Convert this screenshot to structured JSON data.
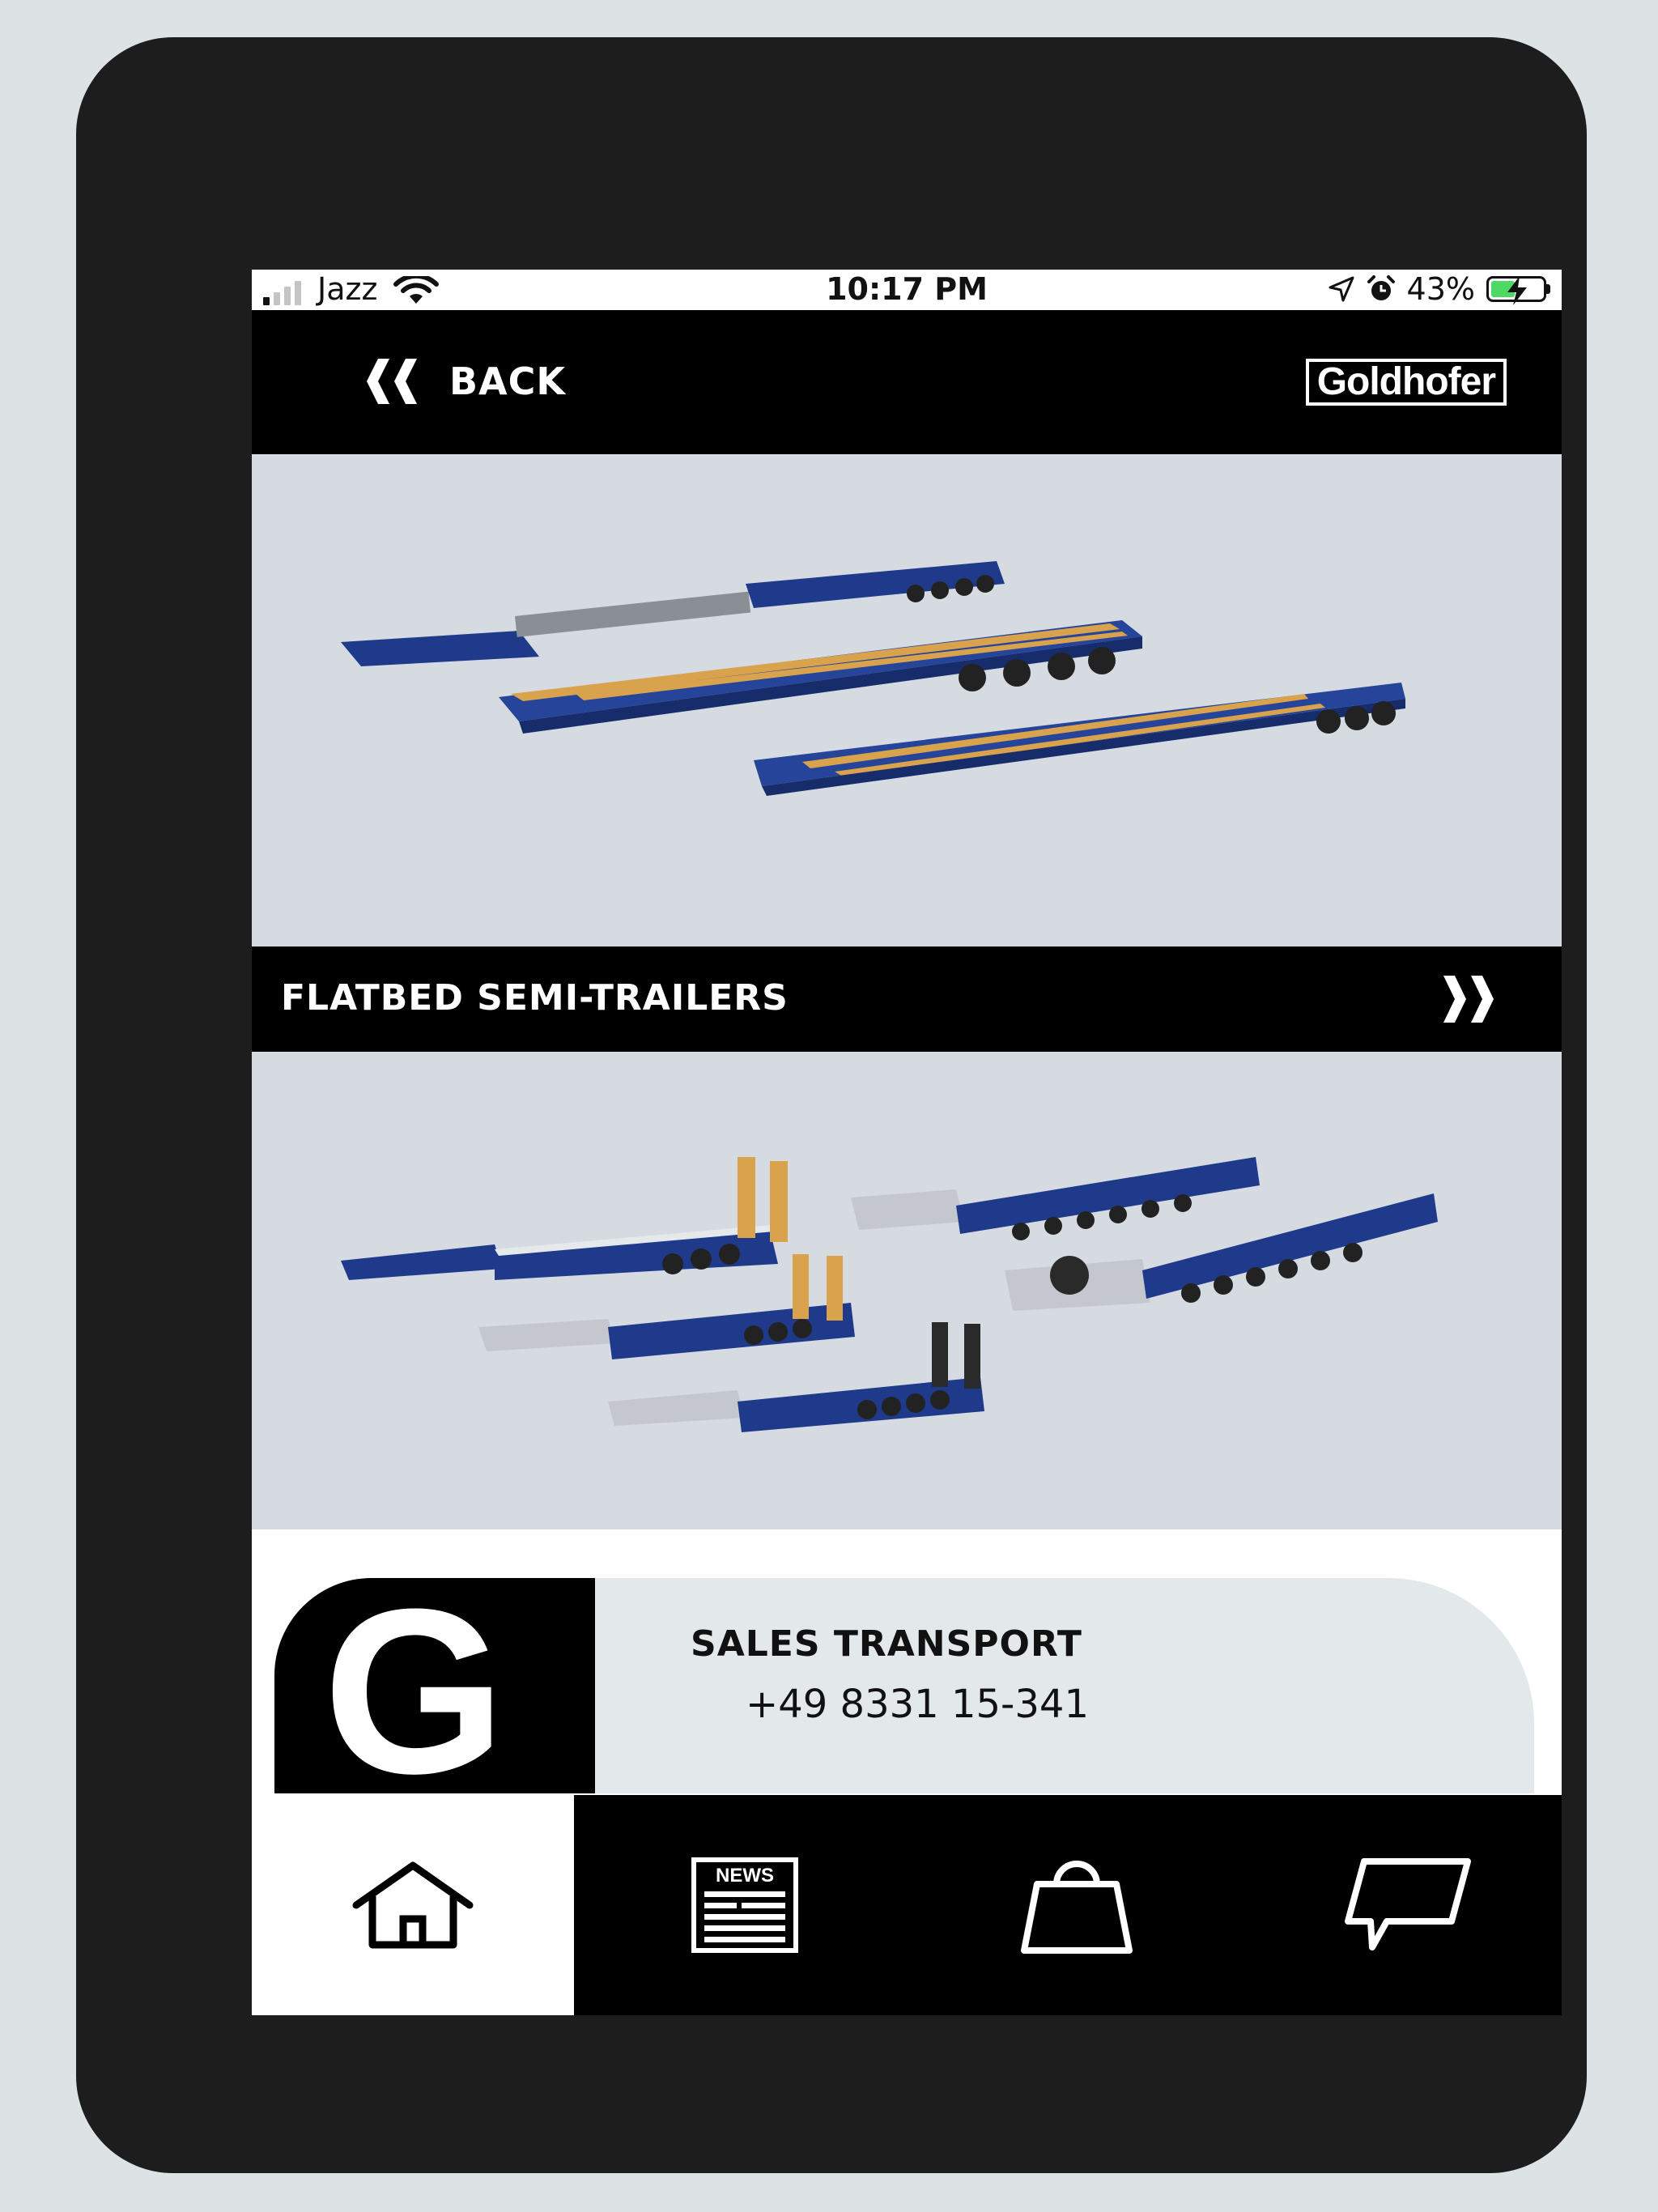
{
  "status_bar": {
    "carrier": "Jazz",
    "time": "10:17 PM",
    "battery": "43%",
    "icons": [
      "signal-icon",
      "wifi-icon",
      "location-icon",
      "alarm-icon",
      "battery-charging-icon"
    ]
  },
  "header": {
    "back_label": "BACK",
    "brand": "Goldhofer"
  },
  "category": {
    "label": "FLATBED SEMI-TRAILERS"
  },
  "contact": {
    "logo_letter": "G",
    "title": "SALES TRANSPORT",
    "phone": "+49 8331 15-341"
  },
  "tabs": {
    "news_label": "NEWS",
    "items": [
      "home",
      "news",
      "shop",
      "chat"
    ],
    "active": "home"
  },
  "colors": {
    "trailer_blue": "#1f3a8a",
    "deck_wood": "#d9a24c",
    "image_bg": "#d5dbe1",
    "panel_bg": "#e3e8eb"
  }
}
